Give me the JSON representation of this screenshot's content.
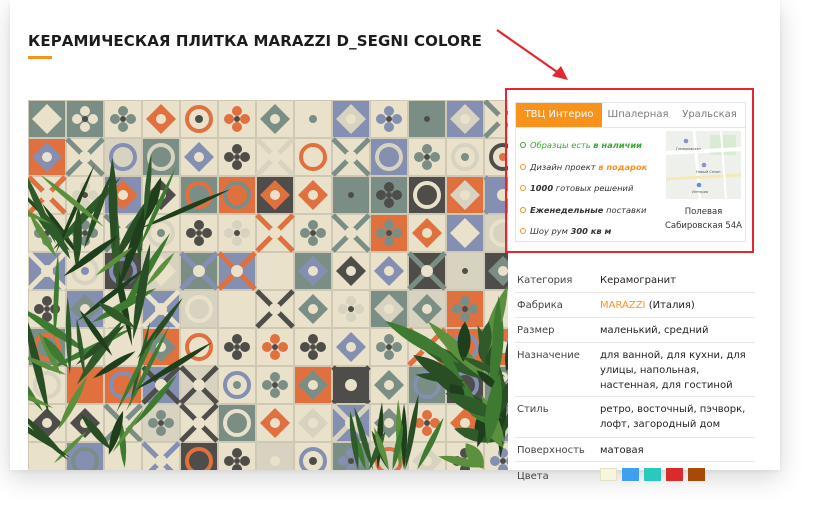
{
  "page": {
    "title": "КЕРАМИЧЕСКАЯ ПЛИТКА MARAZZI D_SEGNI COLORE",
    "accent_color": "#f7931d"
  },
  "image": {
    "alt": "Керамическая плитка Marazzi D_Segni Colore",
    "tile_colors": [
      "#e1703f",
      "#848fb1",
      "#7b8e86",
      "#e9e1c9",
      "#4e4d4a",
      "#d8d3c0"
    ]
  },
  "store_panel": {
    "highlight_color": "#e3262f",
    "tabs": [
      {
        "label": "ТВЦ Интерио",
        "active": true
      },
      {
        "label": "Шпалерная",
        "active": false
      },
      {
        "label": "Уральская",
        "active": false
      }
    ],
    "features": [
      {
        "pre": "Образцы есть ",
        "bold": "в наличии",
        "post": ""
      },
      {
        "pre": "Дизайн проект ",
        "bold": "в подарок",
        "post": ""
      },
      {
        "pre": "",
        "bold": "1000",
        "post": " готовых решений"
      },
      {
        "pre": "",
        "bold": "Еженедельные",
        "post": " поставки"
      },
      {
        "pre": "Шоу рум ",
        "bold": "300 кв м",
        "post": ""
      }
    ],
    "map": {
      "labels": [
        "Гипермаркет",
        "Новый Сезон",
        "Интерио"
      ]
    },
    "address_line1": "Полевая",
    "address_line2": "Сабировская 54А"
  },
  "specs": [
    {
      "label": "Категория",
      "value": "Керамогранит"
    },
    {
      "label": "Фабрика",
      "maker": "MARAZZI",
      "value": " (Италия)"
    },
    {
      "label": "Размер",
      "value": "маленький, средний"
    },
    {
      "label": "Назначение",
      "value": "для ванной, для кухни, для улицы, напольная, настенная, для гостиной"
    },
    {
      "label": "Стиль",
      "value": "ретро, восточный, пэчворк, лофт, загородный дом"
    },
    {
      "label": "Поверхность",
      "value": "матовая"
    },
    {
      "label": "Цвета",
      "colors": [
        "#f8f5dd",
        "#3fa0ee",
        "#29c9bd",
        "#d92b2b",
        "#a84a05"
      ]
    }
  ],
  "annotation": {
    "arrow_color": "#e3262f"
  }
}
